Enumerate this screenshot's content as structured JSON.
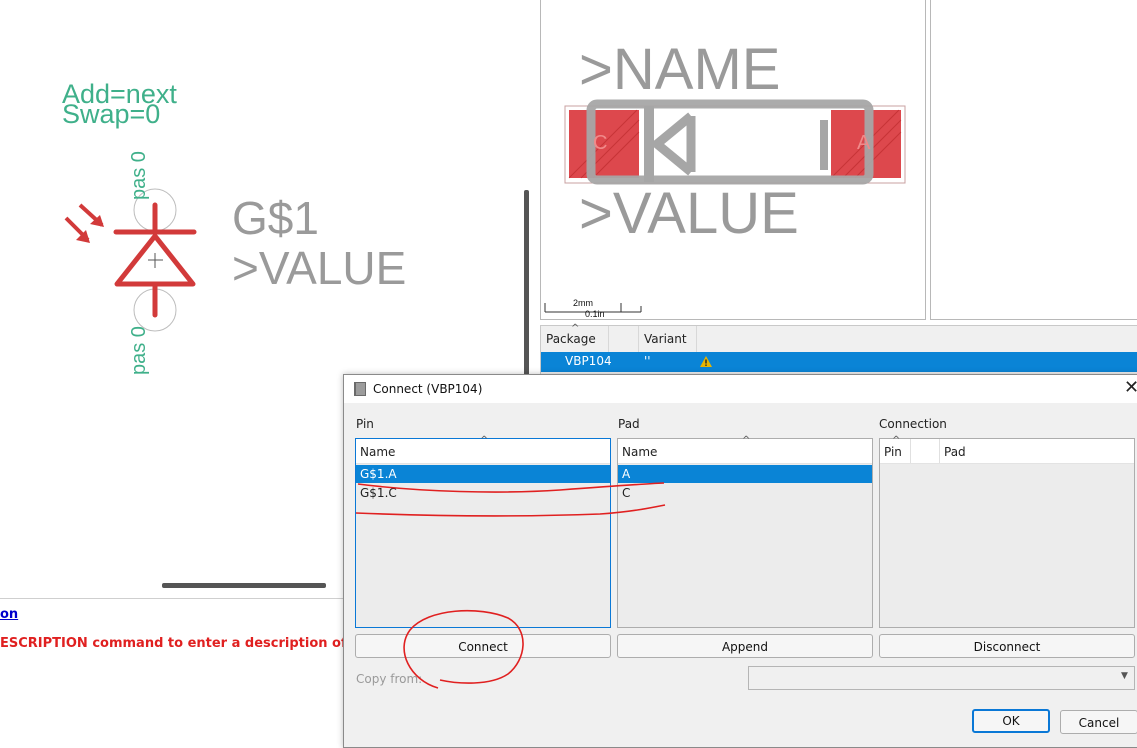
{
  "schematic": {
    "add_attr": "Add=next",
    "swap_attr": "Swap=0",
    "gate_name": "G$1",
    "value_placeholder": ">VALUE",
    "pin_top_label": "pas 0",
    "pin_bottom_label": "pas 0",
    "colors": {
      "symbol": "#d23a3a",
      "attribute": "#3fb08a",
      "placeholder": "#9a9a9a"
    }
  },
  "description_panel": {
    "link_text": "on",
    "hint_text": "ESCRIPTION command to enter a description of this"
  },
  "package_preview": {
    "name_placeholder": ">NAME",
    "value_placeholder": ">VALUE",
    "pad_c": "C",
    "pad_a": "A",
    "scale_mm": "2mm",
    "scale_in": "0.1in",
    "colors": {
      "pad": "#d9343a",
      "silkscreen": "#a6a6a6"
    }
  },
  "package_table": {
    "headers": [
      "Package",
      "Variant"
    ],
    "rows": [
      {
        "package": "VBP104",
        "variant": "''",
        "warning_icon": "warning-icon"
      }
    ]
  },
  "connect_dialog": {
    "title": "Connect  (VBP104)",
    "pin_group": "Pin",
    "pad_group": "Pad",
    "connection_group": "Connection",
    "pin_list": {
      "header": "Name",
      "items": [
        "G$1.A",
        "G$1.C"
      ],
      "selected": "G$1.A"
    },
    "pad_list": {
      "header": "Name",
      "items": [
        "A",
        "C"
      ],
      "selected": "A"
    },
    "connection_list": {
      "headers": [
        "Pin",
        "Pad"
      ]
    },
    "buttons": {
      "connect": "Connect",
      "append": "Append",
      "disconnect": "Disconnect",
      "ok": "OK",
      "cancel": "Cancel"
    },
    "copy_from_label": "Copy from:",
    "copy_from_value": "",
    "accent_color": "#0a84d6"
  }
}
